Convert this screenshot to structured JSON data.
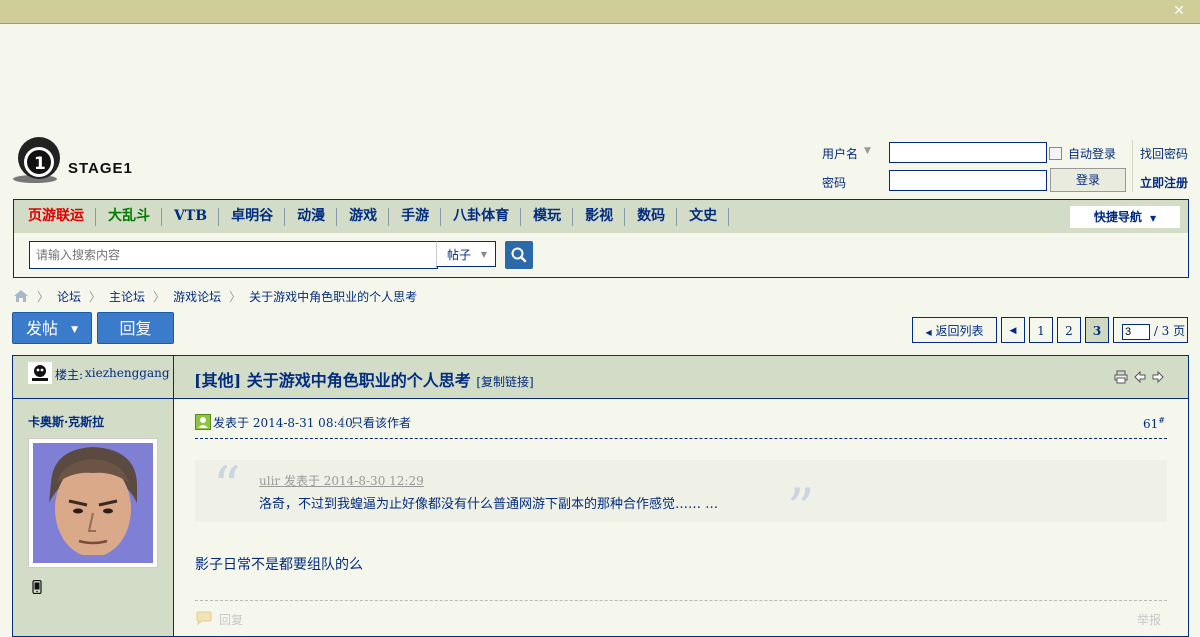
{
  "topbar": {
    "close_icon": "close-icon"
  },
  "logo": {
    "text": "STAGE1"
  },
  "login": {
    "username_label": "用户名",
    "password_label": "密码",
    "auto_login_label": "自动登录",
    "login_button": "登录",
    "forgot_password": "找回密码",
    "register": "立即注册"
  },
  "nav": {
    "items": [
      "页游联运",
      "大乱斗",
      "VTB",
      "卓明谷",
      "动漫",
      "游戏",
      "手游",
      "八卦体育",
      "模玩",
      "影视",
      "数码",
      "文史"
    ],
    "quick_nav": "快捷导航"
  },
  "search": {
    "placeholder": "请输入搜索内容",
    "type": "帖子"
  },
  "breadcrumb": [
    "论坛",
    "主论坛",
    "游戏论坛",
    "关于游戏中角色职业的个人思考"
  ],
  "actions": {
    "new_post": "发帖",
    "reply": "回复"
  },
  "pager": {
    "back": "返回列表",
    "pages": [
      "1",
      "2",
      "3"
    ],
    "current": "3",
    "total": "/ 3 页"
  },
  "thread": {
    "op_label": "楼主:",
    "op_name": "xiezhenggang",
    "category": "[其他]",
    "title": "关于游戏中角色职业的个人思考",
    "copy_link": "[复制链接]"
  },
  "post": {
    "author": "卡奥斯·克斯拉",
    "posted_at": "发表于 2014-8-31 08:40",
    "only_author": "只看该作者",
    "floor": "61",
    "floor_mark": "#",
    "quote_header": "ulir 发表于 2014-8-30 12:29",
    "quote_text": "洛奇，不过到我蝗逼为止好像都没有什么普通网游下副本的那种合作感觉…… …",
    "body": "影子日常不是都要组队的么",
    "reply_label": "回复",
    "report_label": "举报"
  },
  "colors": {
    "accent": "#022c80",
    "nav_bg": "#d3dcc6",
    "page_bg": "#f5f7ec",
    "highlight_red": "#e00000",
    "highlight_green": "#007a00",
    "button_blue": "#3a7bcc"
  }
}
